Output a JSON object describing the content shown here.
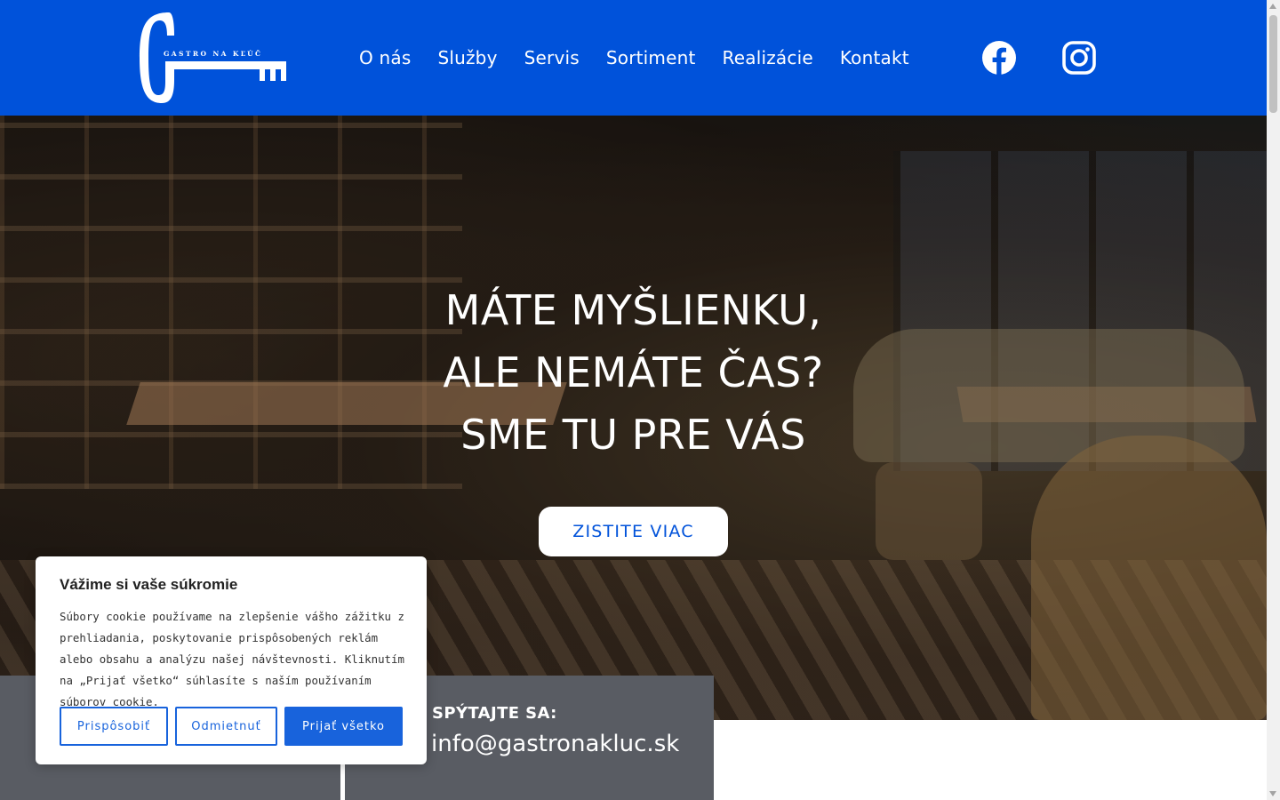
{
  "header": {
    "logo_text": "GASTRO NA KĽÚČ",
    "nav": [
      {
        "label": "O nás"
      },
      {
        "label": "Služby"
      },
      {
        "label": "Servis"
      },
      {
        "label": "Sortiment"
      },
      {
        "label": "Realizácie"
      },
      {
        "label": "Kontakt"
      }
    ],
    "social": [
      "facebook-icon",
      "instagram-icon"
    ]
  },
  "hero": {
    "title_lines": [
      "MÁTE MYŠLIENKU,",
      "ALE NEMÁTE ČAS?",
      "SME TU PRE VÁS"
    ],
    "cta_label": "ZISTITE VIAC"
  },
  "contact": {
    "ask_label": "SPÝTAJTE SA:",
    "email": "info@gastronakluc.sk"
  },
  "cookie_banner": {
    "title": "Vážime si vaše súkromie",
    "text": "Súbory cookie používame na zlepšenie vášho zážitku z prehliadania, poskytovanie prispôsobených reklám alebo obsahu a analýzu našej návštevnosti. Kliknutím na „Prijať všetko“ súhlasíte s naším používaním súborov cookie.",
    "customize_label": "Prispôsobiť",
    "reject_label": "Odmietnuť",
    "accept_label": "Prijať všetko"
  },
  "colors": {
    "brand_blue": "#0052da",
    "cookie_blue": "#1863dc",
    "strip_gray": "#595c63"
  }
}
